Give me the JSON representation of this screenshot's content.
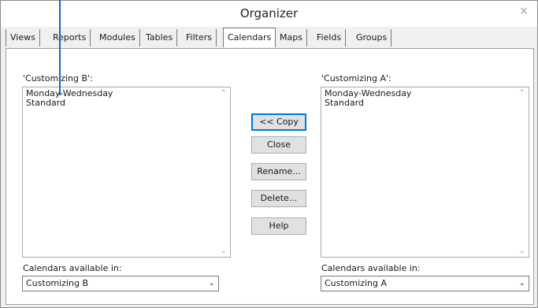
{
  "window": {
    "title": "Organizer",
    "close_icon": "×"
  },
  "tabs": [
    {
      "label": "Views"
    },
    {
      "label": "Reports"
    },
    {
      "label": "Modules"
    },
    {
      "label": "Tables"
    },
    {
      "label": "Filters"
    },
    {
      "label": "Calendars",
      "active": true
    },
    {
      "label": "Maps"
    },
    {
      "label": "Fields"
    },
    {
      "label": "Groups"
    }
  ],
  "left": {
    "list_label": "'Customizing B':",
    "items": [
      "Monday-Wednesday",
      "Standard"
    ],
    "available_label": "Calendars available in:",
    "available_value": "Customizing B"
  },
  "right": {
    "list_label": "'Customizing A':",
    "items": [
      "Monday-Wednesday",
      "Standard"
    ],
    "available_label": "Calendars available in:",
    "available_value": "Customizing A"
  },
  "buttons": {
    "copy": "<< Copy",
    "close": "Close",
    "rename": "Rename...",
    "delete": "Delete...",
    "help": "Help"
  },
  "icons": {
    "scroll_up": "⌃",
    "scroll_down": "⌄",
    "dropdown": "⌄"
  },
  "colors": {
    "callout_line": "#1565c0",
    "default_button_border": "#0078d7"
  }
}
